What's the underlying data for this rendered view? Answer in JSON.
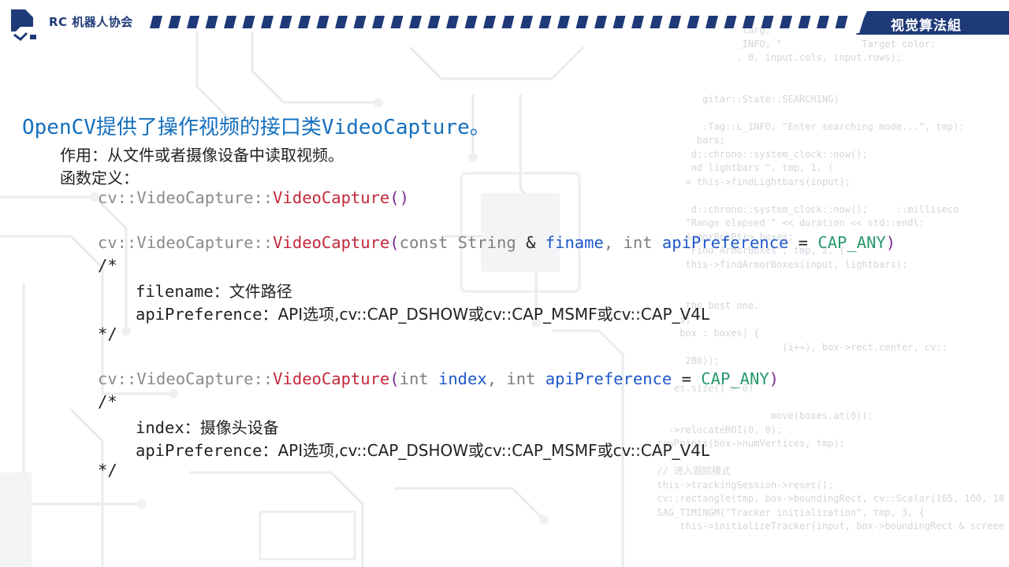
{
  "header": {
    "org_name": "RC 机器人协会",
    "group_title": "视觉算法組"
  },
  "slide": {
    "title": "OpenCV提供了操作视频的接口类VideoCapture。",
    "purpose_line": "作用：从文件或者摄像设备中读取视频。",
    "definition_label": "函数定义：",
    "sig1": {
      "ns": "cv::VideoCapture::",
      "fn": "VideoCapture",
      "paren_open": "(",
      "paren_close": ")"
    },
    "sig2": {
      "ns": "cv::VideoCapture::",
      "fn": "VideoCapture",
      "paren_open": "(",
      "t1": "const String",
      "amp": " & ",
      "p1": "finame",
      "comma": ", ",
      "t2": "int",
      "p2": "apiPreference",
      "eq": " = ",
      "def": "CAP_ANY",
      "paren_close": ")"
    },
    "comment1": {
      "open": "/*",
      "line1_name": "filename",
      "line1_desc": "：文件路径",
      "line2_name": "apiPreference",
      "line2_desc": "：API选项,cv::CAP_DSHOW或cv::CAP_MSMF或cv::CAP_V4L",
      "close": "*/"
    },
    "sig3": {
      "ns": "cv::VideoCapture::",
      "fn": "VideoCapture",
      "paren_open": "(",
      "t1": "int",
      "p1": "index",
      "comma": ", ",
      "t2": "int",
      "p2": "apiPreference",
      "eq": " = ",
      "def": "CAP_ANY",
      "paren_close": ")"
    },
    "comment2": {
      "open": "/*",
      "line1_name": "index",
      "line1_desc": "：摄像头设备",
      "line2_name": "apiPreference",
      "line2_desc": "：API选项,cv::CAP_DSHOW或cv::CAP_MSMF或cv::CAP_V4L",
      "close": "*/"
    }
  },
  "background_code": [
    "                     larg,",
    "                    _INFO, \"              Target color:",
    "                    , 0, input.cols, input.rows);",
    "",
    "",
    "              gitar::State::SEARCHING)",
    "",
    "              :Tag::L_INFO, \"Enter searching mode...\", tmp);",
    "             bars;",
    "            d::chrono::system_clock::now();",
    "            nd lightbars \", tmp, 1, (",
    "           = this->findLightbars(input);",
    "",
    "            d::chrono::system_clock::now();     ::milliseco",
    "           \"Range elapsed \" << duration << std::endl;",
    "           ArmorBoxPtr> boxes;",
    "           \"Find ArmorBoxes\", tmp, 2, (",
    "           this->findArmorBoxes(input, lightbars);",
    "",
    "",
    "           the best one.",
    "          s;",
    "          box : boxes) {",
    "                            (i++), box->rect.center, cv::",
    "           280));",
    "",
    "         es.size() > 0)",
    "",
    "                          move(boxes.at(0));",
    "        ->relocateROI(0, 0);",
    "      rawPoints(box->numVertices, tmp);",
    "",
    "      // 进入跟踪模式",
    "      this->trackingSession->reset();",
    "      cv::rectangle(tmp, box->boundingRect, cv::Scalar(165, 100, 18",
    "      SAG_TIMINGM(\"Tracker initialization\", tmp, 3, {",
    "          this->initializeTracker(input, box->boundingRect & screen"
  ]
}
